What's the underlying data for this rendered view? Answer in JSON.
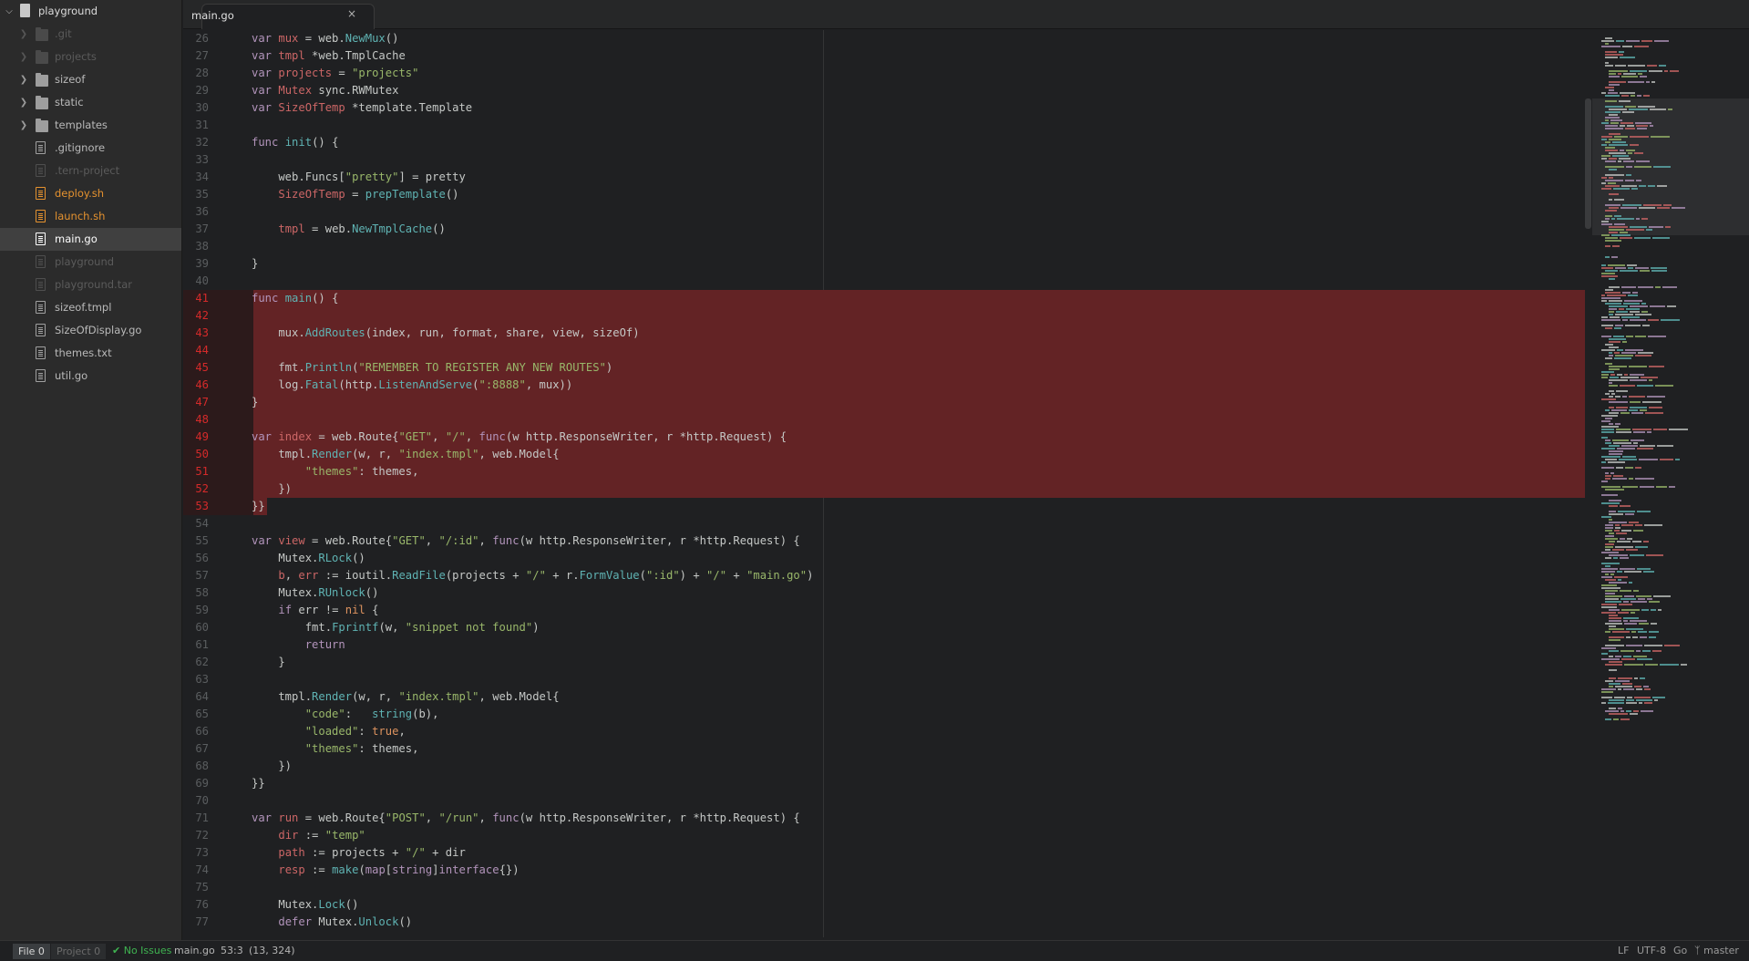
{
  "tree": {
    "root": "playground",
    "items": [
      {
        "label": ".git",
        "type": "folder",
        "state": "dim"
      },
      {
        "label": "projects",
        "type": "folder",
        "state": "dim"
      },
      {
        "label": "sizeof",
        "type": "folder",
        "state": "normal"
      },
      {
        "label": "static",
        "type": "folder",
        "state": "normal"
      },
      {
        "label": "templates",
        "type": "folder",
        "state": "normal"
      },
      {
        "label": ".gitignore",
        "type": "file",
        "state": "normal"
      },
      {
        "label": ".tern-project",
        "type": "file",
        "state": "dim"
      },
      {
        "label": "deploy.sh",
        "type": "file",
        "state": "orange"
      },
      {
        "label": "launch.sh",
        "type": "file",
        "state": "orange"
      },
      {
        "label": "main.go",
        "type": "file",
        "state": "white",
        "selected": true
      },
      {
        "label": "playground",
        "type": "file",
        "state": "dim"
      },
      {
        "label": "playground.tar",
        "type": "file",
        "state": "dim"
      },
      {
        "label": "sizeof.tmpl",
        "type": "file",
        "state": "normal"
      },
      {
        "label": "SizeOfDisplay.go",
        "type": "file",
        "state": "normal"
      },
      {
        "label": "themes.txt",
        "type": "file",
        "state": "normal"
      },
      {
        "label": "util.go",
        "type": "file",
        "state": "normal"
      }
    ]
  },
  "tab": {
    "title": "main.go",
    "close_icon": "×"
  },
  "editor": {
    "highlight_color": "#632325",
    "highlight_from": 41,
    "highlight_to": 53,
    "lines": [
      {
        "n": 26,
        "tokens": [
          [
            "k",
            "var"
          ],
          [
            "t",
            " "
          ],
          [
            "v",
            "mux"
          ],
          [
            "t",
            " = web."
          ],
          [
            "f",
            "NewMux"
          ],
          [
            "t",
            "()"
          ]
        ]
      },
      {
        "n": 27,
        "tokens": [
          [
            "k",
            "var"
          ],
          [
            "t",
            " "
          ],
          [
            "v",
            "tmpl"
          ],
          [
            "t",
            " *web.TmplCache"
          ]
        ]
      },
      {
        "n": 28,
        "tokens": [
          [
            "k",
            "var"
          ],
          [
            "t",
            " "
          ],
          [
            "v",
            "projects"
          ],
          [
            "t",
            " = "
          ],
          [
            "s",
            "\"projects\""
          ]
        ]
      },
      {
        "n": 29,
        "tokens": [
          [
            "k",
            "var"
          ],
          [
            "t",
            " "
          ],
          [
            "v",
            "Mutex"
          ],
          [
            "t",
            " sync.RWMutex"
          ]
        ]
      },
      {
        "n": 30,
        "tokens": [
          [
            "k",
            "var"
          ],
          [
            "t",
            " "
          ],
          [
            "v",
            "SizeOfTemp"
          ],
          [
            "t",
            " *template.Template"
          ]
        ]
      },
      {
        "n": 31,
        "tokens": []
      },
      {
        "n": 32,
        "tokens": [
          [
            "k",
            "func"
          ],
          [
            "t",
            " "
          ],
          [
            "f",
            "init"
          ],
          [
            "t",
            "() {"
          ]
        ]
      },
      {
        "n": 33,
        "tokens": []
      },
      {
        "n": 34,
        "tokens": [
          [
            "t",
            "    web.Funcs["
          ],
          [
            "s",
            "\"pretty\""
          ],
          [
            "t",
            "] = pretty"
          ]
        ]
      },
      {
        "n": 35,
        "tokens": [
          [
            "t",
            "    "
          ],
          [
            "v",
            "SizeOfTemp"
          ],
          [
            "t",
            " = "
          ],
          [
            "f",
            "prepTemplate"
          ],
          [
            "t",
            "()"
          ]
        ]
      },
      {
        "n": 36,
        "tokens": []
      },
      {
        "n": 37,
        "tokens": [
          [
            "t",
            "    "
          ],
          [
            "v",
            "tmpl"
          ],
          [
            "t",
            " = web."
          ],
          [
            "f",
            "NewTmplCache"
          ],
          [
            "t",
            "()"
          ]
        ]
      },
      {
        "n": 38,
        "tokens": []
      },
      {
        "n": 39,
        "tokens": [
          [
            "t",
            "}"
          ]
        ]
      },
      {
        "n": 40,
        "tokens": []
      },
      {
        "n": 41,
        "tokens": [
          [
            "k",
            "func"
          ],
          [
            "t",
            " "
          ],
          [
            "f",
            "main"
          ],
          [
            "t",
            "() {"
          ]
        ]
      },
      {
        "n": 42,
        "tokens": []
      },
      {
        "n": 43,
        "tokens": [
          [
            "t",
            "    mux."
          ],
          [
            "f",
            "AddRoutes"
          ],
          [
            "t",
            "(index, run, format, share, view, sizeOf)"
          ]
        ]
      },
      {
        "n": 44,
        "tokens": []
      },
      {
        "n": 45,
        "tokens": [
          [
            "t",
            "    fmt."
          ],
          [
            "f",
            "Println"
          ],
          [
            "t",
            "("
          ],
          [
            "s",
            "\"REMEMBER TO REGISTER ANY NEW ROUTES\""
          ],
          [
            "t",
            ")"
          ]
        ]
      },
      {
        "n": 46,
        "tokens": [
          [
            "t",
            "    log."
          ],
          [
            "f",
            "Fatal"
          ],
          [
            "t",
            "(http."
          ],
          [
            "f",
            "ListenAndServe"
          ],
          [
            "t",
            "("
          ],
          [
            "s",
            "\":8888\""
          ],
          [
            "t",
            ", mux))"
          ]
        ]
      },
      {
        "n": 47,
        "tokens": [
          [
            "t",
            "}"
          ]
        ]
      },
      {
        "n": 48,
        "tokens": []
      },
      {
        "n": 49,
        "tokens": [
          [
            "k",
            "var"
          ],
          [
            "t",
            " "
          ],
          [
            "v",
            "index"
          ],
          [
            "t",
            " = web.Route{"
          ],
          [
            "s",
            "\"GET\""
          ],
          [
            "t",
            ", "
          ],
          [
            "s",
            "\"/\""
          ],
          [
            "t",
            ", "
          ],
          [
            "k",
            "func"
          ],
          [
            "t",
            "(w http.ResponseWriter, r *http.Request) {"
          ]
        ]
      },
      {
        "n": 50,
        "tokens": [
          [
            "t",
            "    tmpl."
          ],
          [
            "f",
            "Render"
          ],
          [
            "t",
            "(w, r, "
          ],
          [
            "s",
            "\"index.tmpl\""
          ],
          [
            "t",
            ", web.Model{"
          ]
        ]
      },
      {
        "n": 51,
        "tokens": [
          [
            "t",
            "        "
          ],
          [
            "s",
            "\"themes\""
          ],
          [
            "t",
            ": themes,"
          ]
        ]
      },
      {
        "n": 52,
        "tokens": [
          [
            "t",
            "    })"
          ]
        ]
      },
      {
        "n": 53,
        "tokens": [
          [
            "t",
            "}}"
          ]
        ]
      },
      {
        "n": 54,
        "tokens": []
      },
      {
        "n": 55,
        "tokens": [
          [
            "k",
            "var"
          ],
          [
            "t",
            " "
          ],
          [
            "v",
            "view"
          ],
          [
            "t",
            " = web.Route{"
          ],
          [
            "s",
            "\"GET\""
          ],
          [
            "t",
            ", "
          ],
          [
            "s",
            "\"/:id\""
          ],
          [
            "t",
            ", "
          ],
          [
            "k",
            "func"
          ],
          [
            "t",
            "(w http.ResponseWriter, r *http.Request) {"
          ]
        ]
      },
      {
        "n": 56,
        "tokens": [
          [
            "t",
            "    Mutex."
          ],
          [
            "f",
            "RLock"
          ],
          [
            "t",
            "()"
          ]
        ]
      },
      {
        "n": 57,
        "tokens": [
          [
            "t",
            "    "
          ],
          [
            "v",
            "b"
          ],
          [
            "t",
            ", "
          ],
          [
            "v",
            "err"
          ],
          [
            "t",
            " := ioutil."
          ],
          [
            "f",
            "ReadFile"
          ],
          [
            "t",
            "(projects + "
          ],
          [
            "s",
            "\"/\""
          ],
          [
            "t",
            " + r."
          ],
          [
            "f",
            "FormValue"
          ],
          [
            "t",
            "("
          ],
          [
            "s",
            "\":id\""
          ],
          [
            "t",
            ") + "
          ],
          [
            "s",
            "\"/\""
          ],
          [
            "t",
            " + "
          ],
          [
            "s",
            "\"main.go\""
          ],
          [
            "t",
            ")"
          ]
        ]
      },
      {
        "n": 58,
        "tokens": [
          [
            "t",
            "    Mutex."
          ],
          [
            "f",
            "RUnlock"
          ],
          [
            "t",
            "()"
          ]
        ]
      },
      {
        "n": 59,
        "tokens": [
          [
            "t",
            "    "
          ],
          [
            "k",
            "if"
          ],
          [
            "t",
            " err != "
          ],
          [
            "n",
            "nil"
          ],
          [
            "t",
            " {"
          ]
        ]
      },
      {
        "n": 60,
        "tokens": [
          [
            "t",
            "        fmt."
          ],
          [
            "f",
            "Fprintf"
          ],
          [
            "t",
            "(w, "
          ],
          [
            "s",
            "\"snippet not found\""
          ],
          [
            "t",
            ")"
          ]
        ]
      },
      {
        "n": 61,
        "tokens": [
          [
            "t",
            "        "
          ],
          [
            "k",
            "return"
          ]
        ]
      },
      {
        "n": 62,
        "tokens": [
          [
            "t",
            "    }"
          ]
        ]
      },
      {
        "n": 63,
        "tokens": []
      },
      {
        "n": 64,
        "tokens": [
          [
            "t",
            "    tmpl."
          ],
          [
            "f",
            "Render"
          ],
          [
            "t",
            "(w, r, "
          ],
          [
            "s",
            "\"index.tmpl\""
          ],
          [
            "t",
            ", web.Model{"
          ]
        ]
      },
      {
        "n": 65,
        "tokens": [
          [
            "t",
            "        "
          ],
          [
            "s",
            "\"code\""
          ],
          [
            "t",
            ":   "
          ],
          [
            "f",
            "string"
          ],
          [
            "t",
            "(b),"
          ]
        ]
      },
      {
        "n": 66,
        "tokens": [
          [
            "t",
            "        "
          ],
          [
            "s",
            "\"loaded\""
          ],
          [
            "t",
            ": "
          ],
          [
            "n",
            "true"
          ],
          [
            "t",
            ","
          ]
        ]
      },
      {
        "n": 67,
        "tokens": [
          [
            "t",
            "        "
          ],
          [
            "s",
            "\"themes\""
          ],
          [
            "t",
            ": themes,"
          ]
        ]
      },
      {
        "n": 68,
        "tokens": [
          [
            "t",
            "    })"
          ]
        ]
      },
      {
        "n": 69,
        "tokens": [
          [
            "t",
            "}}"
          ]
        ]
      },
      {
        "n": 70,
        "tokens": []
      },
      {
        "n": 71,
        "tokens": [
          [
            "k",
            "var"
          ],
          [
            "t",
            " "
          ],
          [
            "v",
            "run"
          ],
          [
            "t",
            " = web.Route{"
          ],
          [
            "s",
            "\"POST\""
          ],
          [
            "t",
            ", "
          ],
          [
            "s",
            "\"/run\""
          ],
          [
            "t",
            ", "
          ],
          [
            "k",
            "func"
          ],
          [
            "t",
            "(w http.ResponseWriter, r *http.Request) {"
          ]
        ]
      },
      {
        "n": 72,
        "tokens": [
          [
            "t",
            "    "
          ],
          [
            "v",
            "dir"
          ],
          [
            "t",
            " := "
          ],
          [
            "s",
            "\"temp\""
          ]
        ]
      },
      {
        "n": 73,
        "tokens": [
          [
            "t",
            "    "
          ],
          [
            "v",
            "path"
          ],
          [
            "t",
            " := projects + "
          ],
          [
            "s",
            "\"/\""
          ],
          [
            "t",
            " + dir"
          ]
        ]
      },
      {
        "n": 74,
        "tokens": [
          [
            "t",
            "    "
          ],
          [
            "v",
            "resp"
          ],
          [
            "t",
            " := "
          ],
          [
            "f",
            "make"
          ],
          [
            "t",
            "("
          ],
          [
            "k",
            "map"
          ],
          [
            "t",
            "["
          ],
          [
            "k",
            "string"
          ],
          [
            "t",
            "]"
          ],
          [
            "k",
            "interface"
          ],
          [
            "t",
            "{})"
          ]
        ]
      },
      {
        "n": 75,
        "tokens": []
      },
      {
        "n": 76,
        "tokens": [
          [
            "t",
            "    Mutex."
          ],
          [
            "f",
            "Lock"
          ],
          [
            "t",
            "()"
          ]
        ]
      },
      {
        "n": 77,
        "tokens": [
          [
            "t",
            "    "
          ],
          [
            "k",
            "defer"
          ],
          [
            "t",
            " Mutex."
          ],
          [
            "f",
            "Unlock"
          ],
          [
            "t",
            "()"
          ]
        ]
      }
    ]
  },
  "statusbar": {
    "file_label": "File 0",
    "project_label": "Project 0",
    "issues": "No Issues",
    "filename": "main.go",
    "cursor": "53:3",
    "selection": "(13, 324)",
    "line_ending": "LF",
    "encoding": "UTF-8",
    "grammar": "Go",
    "branch": "master"
  },
  "colors": {
    "keyword": "#b294bb",
    "variable": "#cc6666",
    "function": "#5fb3b3",
    "string": "#99b76a",
    "constant": "#de935f",
    "text": "#c5c8c6",
    "status_ok": "#3fb451",
    "modified_file": "#e5922f"
  }
}
